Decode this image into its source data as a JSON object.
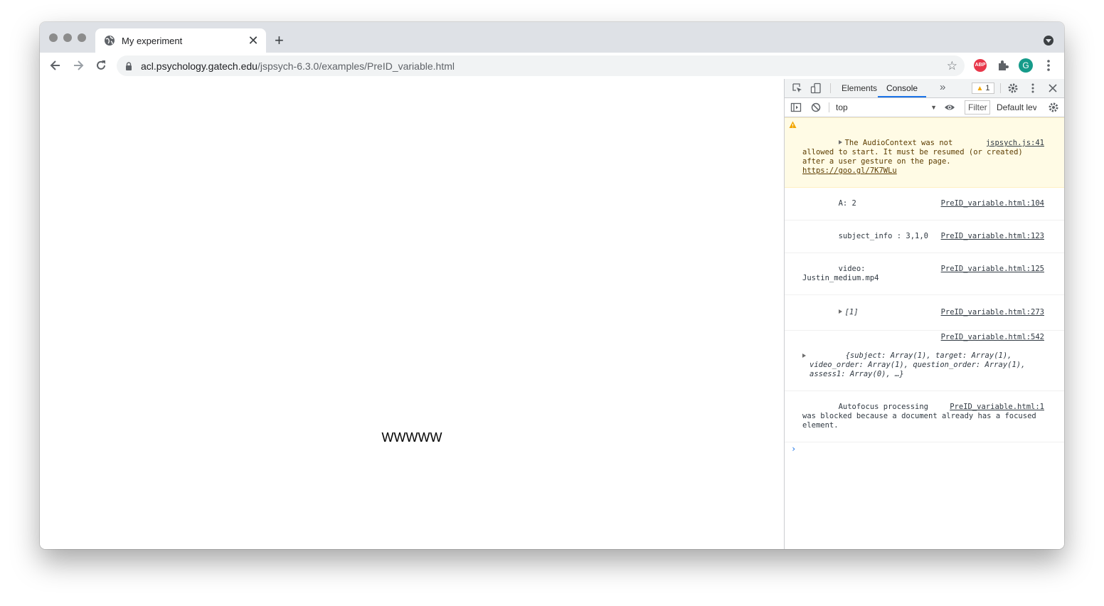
{
  "browser": {
    "tab": {
      "title": "My experiment",
      "close": "✕"
    },
    "new_tab": "+",
    "url": {
      "host": "acl.psychology.gatech.edu",
      "path": "/jspsych-6.3.0/examples/PreID_variable.html"
    },
    "avatar_letter": "G",
    "abp_label": "ABP"
  },
  "page": {
    "stimulus_text": "WWWWW"
  },
  "devtools": {
    "tabs": [
      {
        "label": "Elements"
      },
      {
        "label": "Console"
      }
    ],
    "more_tabs": "»",
    "warning_count": "1",
    "context": "top",
    "filter_placeholder": "Filter",
    "levels_label": "Default levels",
    "messages": [
      {
        "type": "warning",
        "text": "The AudioContext was not allowed to start. It must be resumed (or created) after a user gesture on the page.",
        "link": "https://goo.gl/7K7WLu",
        "source": "jspsych.js:41"
      },
      {
        "type": "log",
        "text": "A: 2",
        "source": "PreID_variable.html:104"
      },
      {
        "type": "log",
        "text": "subject_info : 3,1,0",
        "source": "PreID_variable.html:123"
      },
      {
        "type": "log",
        "text": "video: Justin_medium.mp4",
        "source": "PreID_variable.html:125"
      },
      {
        "type": "log",
        "text": "[1]",
        "source": "PreID_variable.html:273"
      },
      {
        "type": "log",
        "text": "{subject: Array(1), target: Array(1), video_order: Array(1), question_order: Array(1), assess1: Array(0), …}",
        "source": "PreID_variable.html:542"
      },
      {
        "type": "log",
        "text": "Autofocus processing was blocked because a document already has a focused element.",
        "source": "PreID_variable.html:1"
      }
    ],
    "prompt": "›"
  }
}
